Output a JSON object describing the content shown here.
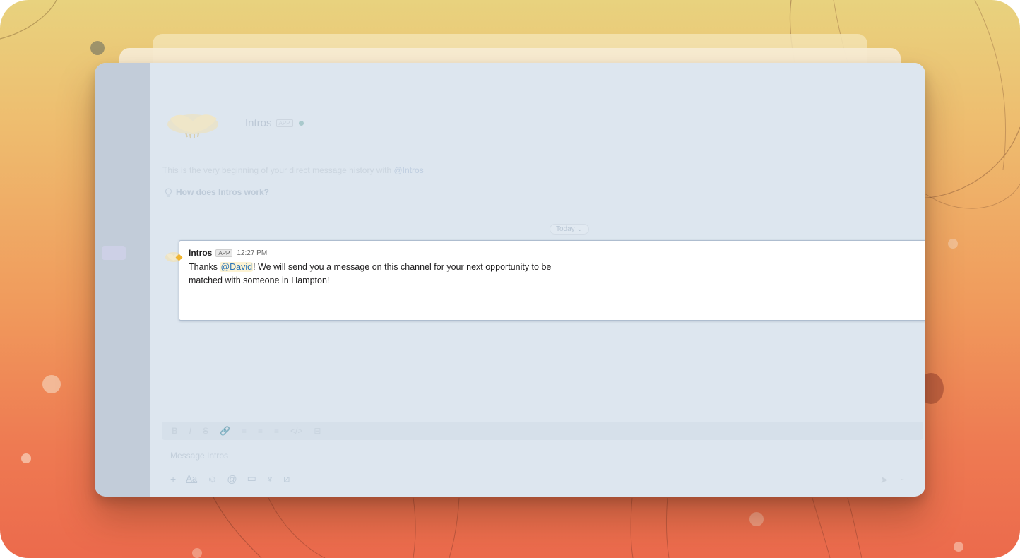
{
  "app": {
    "name": "Intros",
    "badge": "APP",
    "intro_text": "This is the very beginning of your direct message history with",
    "intro_mention": "@Intros",
    "how_link": "How does Intros work?"
  },
  "divider": {
    "label": "Today",
    "chevron": "⌄"
  },
  "message": {
    "sender": "Intros",
    "badge": "APP",
    "time": "12:27 PM",
    "text_before": "Thanks ",
    "mention": "@David",
    "text_after": "! We will send you a message on this channel for your next opportunity to be matched with someone in Hampton!"
  },
  "composer": {
    "placeholder": "Message Intros",
    "toolbar": [
      "B",
      "I",
      "S",
      "🔗",
      "≡",
      "≡",
      "≡",
      "</>",
      "⊟"
    ],
    "actions": [
      "+",
      "Aa",
      "☺",
      "@",
      "▭",
      "♆",
      "⧄"
    ],
    "send": "➤",
    "send_more": "⌄"
  },
  "colors": {
    "bg_top": "#e8d27e",
    "bg_bottom": "#ec6a4c",
    "window_bg": "#dde6ef",
    "sidebar_bg": "#c2ccd9",
    "mention_bg": "#fdf3d3",
    "mention_fg": "#2873b7"
  },
  "icons": {
    "app_avatar": "handshake-icon",
    "how_link": "lightbulb-icon",
    "send": "send-icon"
  }
}
